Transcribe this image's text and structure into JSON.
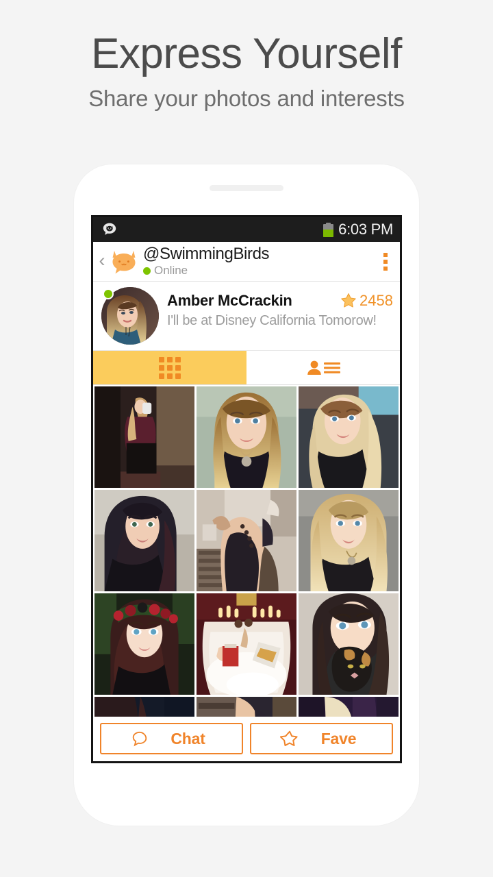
{
  "promo": {
    "title": "Express Yourself",
    "subtitle": "Share your photos and interests"
  },
  "colors": {
    "page_background": "#f4f4f4",
    "accent_orange": "#f0842a",
    "tab_active_yellow": "#fbcc5c",
    "online_green": "#7ec400",
    "battery_green": "#7cb900",
    "statusbar_black": "#1d1d1d",
    "headline_gray": "#4b4b4b",
    "subhead_gray": "#6e6e6e"
  },
  "statusbar": {
    "notification_icon": "cat-chat-icon",
    "battery_icon": "battery-icon",
    "time": "6:03 PM"
  },
  "appbar": {
    "back_icon": "back-chevron-icon",
    "logo_icon": "cat-logo-icon",
    "handle": "@SwimmingBirds",
    "presence": "Online",
    "overflow_icon": "overflow-menu-icon"
  },
  "profile": {
    "avatar_icon": "user-avatar",
    "online_indicator": "online-dot",
    "name": "Amber McCrackin",
    "status": "I'll be at Disney California Tomorow!",
    "star_icon": "star-icon",
    "fave_count": "2458"
  },
  "tabs": [
    {
      "id": "photos",
      "icon": "grid-icon",
      "active": true
    },
    {
      "id": "profile-info",
      "icon": "person-list-icon",
      "active": false
    }
  ],
  "gallery": {
    "photos": [
      {
        "id": "photo-1",
        "alt": "Mirror selfie in dark room"
      },
      {
        "id": "photo-2",
        "alt": "Portrait with long blonde ombre hair"
      },
      {
        "id": "photo-3",
        "alt": "Car selfie looking upward"
      },
      {
        "id": "photo-4",
        "alt": "Selfie with dark teal hair"
      },
      {
        "id": "photo-5",
        "alt": "Shoulder tattoo photo"
      },
      {
        "id": "photo-6",
        "alt": "Blonde portrait with necklace"
      },
      {
        "id": "photo-7",
        "alt": "Rose flower crown portrait"
      },
      {
        "id": "photo-8",
        "alt": "Bubble bath with candles and snacks"
      },
      {
        "id": "photo-9",
        "alt": "Holding a calico cat"
      },
      {
        "id": "photo-10",
        "alt": "Dark partial photo"
      },
      {
        "id": "photo-11",
        "alt": "Partial photo with patterned background"
      },
      {
        "id": "photo-12",
        "alt": "Partial blonde hair photo"
      }
    ]
  },
  "actions": [
    {
      "id": "chat",
      "icon": "chat-bubble-icon",
      "label": "Chat"
    },
    {
      "id": "fave",
      "icon": "star-outline-icon",
      "label": "Fave"
    }
  ]
}
